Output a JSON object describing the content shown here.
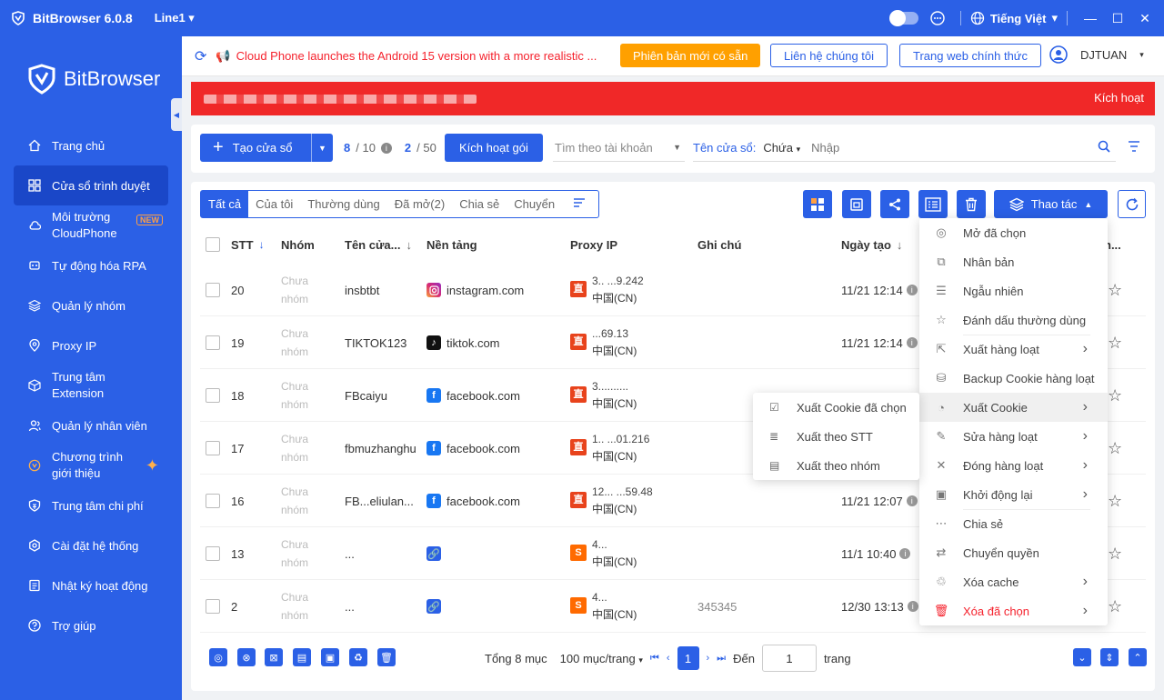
{
  "titlebar": {
    "app": "BitBrowser 6.0.8",
    "line": "Line1",
    "language": "Tiếng Việt"
  },
  "sidebar": {
    "brand": "BitBrowser",
    "items": [
      {
        "label": "Trang chủ",
        "icon": "home-icon"
      },
      {
        "label": "Cửa sổ trình duyệt",
        "icon": "grid-icon",
        "active": true
      },
      {
        "label": "Môi trường CloudPhone",
        "icon": "cloud-icon",
        "badge": "NEW"
      },
      {
        "label": "Tự động hóa RPA",
        "icon": "rpa-icon"
      },
      {
        "label": "Quản lý nhóm",
        "icon": "layers-icon"
      },
      {
        "label": "Proxy IP",
        "icon": "location-icon"
      },
      {
        "label": "Trung tâm Extension",
        "icon": "cube-icon"
      },
      {
        "label": "Quản lý nhân viên",
        "icon": "users-icon"
      },
      {
        "label": "Chương trình giới thiệu",
        "icon": "gift-icon"
      },
      {
        "label": "Trung tâm chi phí",
        "icon": "shield-icon"
      },
      {
        "label": "Cài đặt hệ thống",
        "icon": "settings-icon"
      },
      {
        "label": "Nhật ký hoạt động",
        "icon": "log-icon"
      },
      {
        "label": "Trợ giúp",
        "icon": "help-icon"
      }
    ]
  },
  "topbar": {
    "notice": "Cloud Phone launches the Android 15 version with a more realistic ...",
    "new_version": "Phiên bản mới có sẵn",
    "contact": "Liên hệ chúng tôi",
    "website": "Trang web chính thức",
    "user": "DJTUAN"
  },
  "redbar": {
    "activate": "Kích hoạt"
  },
  "toolbar": {
    "create": "Tạo cửa sổ",
    "count1_used": "8",
    "count1_total": "/ 10",
    "count2_used": "2",
    "count2_total": "/ 50",
    "activate_pkg": "Kích hoạt gói",
    "search_account": "Tìm theo tài khoản",
    "field_label": "Tên cửa sổ:",
    "field_op": "Chứa",
    "field_placeholder": "Nhập"
  },
  "tabs": [
    "Tất cả",
    "Của tôi",
    "Thường dùng",
    "Đã mở(2)",
    "Chia sẻ",
    "Chuyển"
  ],
  "actions": {
    "label": "Thao tác"
  },
  "table": {
    "headers": {
      "stt": "STT",
      "group": "Nhóm",
      "name": "Tên cửa...",
      "platform": "Nền tảng",
      "proxy": "Proxy IP",
      "note": "Ghi chú",
      "created": "Ngày tạo",
      "partial": "h..."
    },
    "rows": [
      {
        "stt": "20",
        "group": "Chưa nhóm",
        "name": "insbtbt",
        "platform": "instagram.com",
        "picon": "instagram-icon",
        "ptype": "直",
        "ip": "3.. ...9.242",
        "region": "中国(CN)",
        "note": "",
        "date": "11/21 12:14"
      },
      {
        "stt": "19",
        "group": "Chưa nhóm",
        "name": "TIKTOK123",
        "platform": "tiktok.com",
        "picon": "tiktok-icon",
        "ptype": "直",
        "ip": "...69.13",
        "region": "中国(CN)",
        "note": "",
        "date": "11/21 12:14"
      },
      {
        "stt": "18",
        "group": "Chưa nhóm",
        "name": "FBcaiyu",
        "platform": "facebook.com",
        "picon": "facebook-icon",
        "ptype": "直",
        "ip": "3..........",
        "region": "中国(CN)",
        "note": "",
        "date": ""
      },
      {
        "stt": "17",
        "group": "Chưa nhóm",
        "name": "fbmuzhanghu",
        "platform": "facebook.com",
        "picon": "facebook-icon",
        "ptype": "直",
        "ip": "1.. ...01.216",
        "region": "中国(CN)",
        "note": "",
        "date": ""
      },
      {
        "stt": "16",
        "group": "Chưa nhóm",
        "name": "FB...eliulan...",
        "platform": "facebook.com",
        "picon": "facebook-icon",
        "ptype": "直",
        "ip": "12... ...59.48",
        "region": "中国(CN)",
        "note": "",
        "date": "11/21 12:07"
      },
      {
        "stt": "13",
        "group": "Chưa nhóm",
        "name": "...",
        "platform": "",
        "picon": "link-icon",
        "ptype": "S",
        "ip": "4...",
        "region": "中国(CN)",
        "note": "",
        "date": "11/1 10:40"
      },
      {
        "stt": "2",
        "group": "Chưa nhóm",
        "name": "...",
        "platform": "",
        "picon": "link-icon",
        "ptype": "S",
        "ip": "4...",
        "region": "中国(CN)",
        "note": "345345",
        "date": "12/30 13:13"
      }
    ]
  },
  "footer": {
    "total": "Tổng 8 mục",
    "per_page": "100 mục/trang",
    "page": "1",
    "goto": "Đến",
    "goto_value": "1",
    "page_suffix": "trang"
  },
  "dropdown": [
    {
      "label": "Mở đã chọn",
      "icon": "chrome-icon"
    },
    {
      "label": "Nhân bản",
      "icon": "copy-icon"
    },
    {
      "label": "Ngẫu nhiên",
      "icon": "random-icon"
    },
    {
      "label": "Đánh dấu thường dùng",
      "icon": "star-icon"
    },
    {
      "label": "Xuất hàng loạt",
      "icon": "export-icon",
      "sub": true
    },
    {
      "label": "Backup Cookie hàng loạt",
      "icon": "backup-icon"
    },
    {
      "label": "Xuất Cookie",
      "icon": "cookie-icon",
      "sub": true,
      "hl": true
    },
    {
      "label": "Sửa hàng loạt",
      "icon": "edit-icon",
      "sub": true
    },
    {
      "label": "Đóng hàng loạt",
      "icon": "close-icon",
      "sub": true
    },
    {
      "label": "Khởi động lại",
      "icon": "restart-icon",
      "sub": true
    },
    {
      "label": "Chia sẻ",
      "icon": "share-icon"
    },
    {
      "label": "Chuyển quyền",
      "icon": "transfer-icon"
    },
    {
      "label": "Xóa cache",
      "icon": "broom-icon",
      "sub": true
    },
    {
      "label": "Xóa đã chọn",
      "icon": "trash-icon",
      "sub": true,
      "danger": true
    }
  ],
  "submenu": [
    {
      "label": "Xuất Cookie đã chọn",
      "icon": "checklist-icon"
    },
    {
      "label": "Xuất theo STT",
      "icon": "list-icon"
    },
    {
      "label": "Xuất theo nhóm",
      "icon": "group-icon"
    }
  ]
}
